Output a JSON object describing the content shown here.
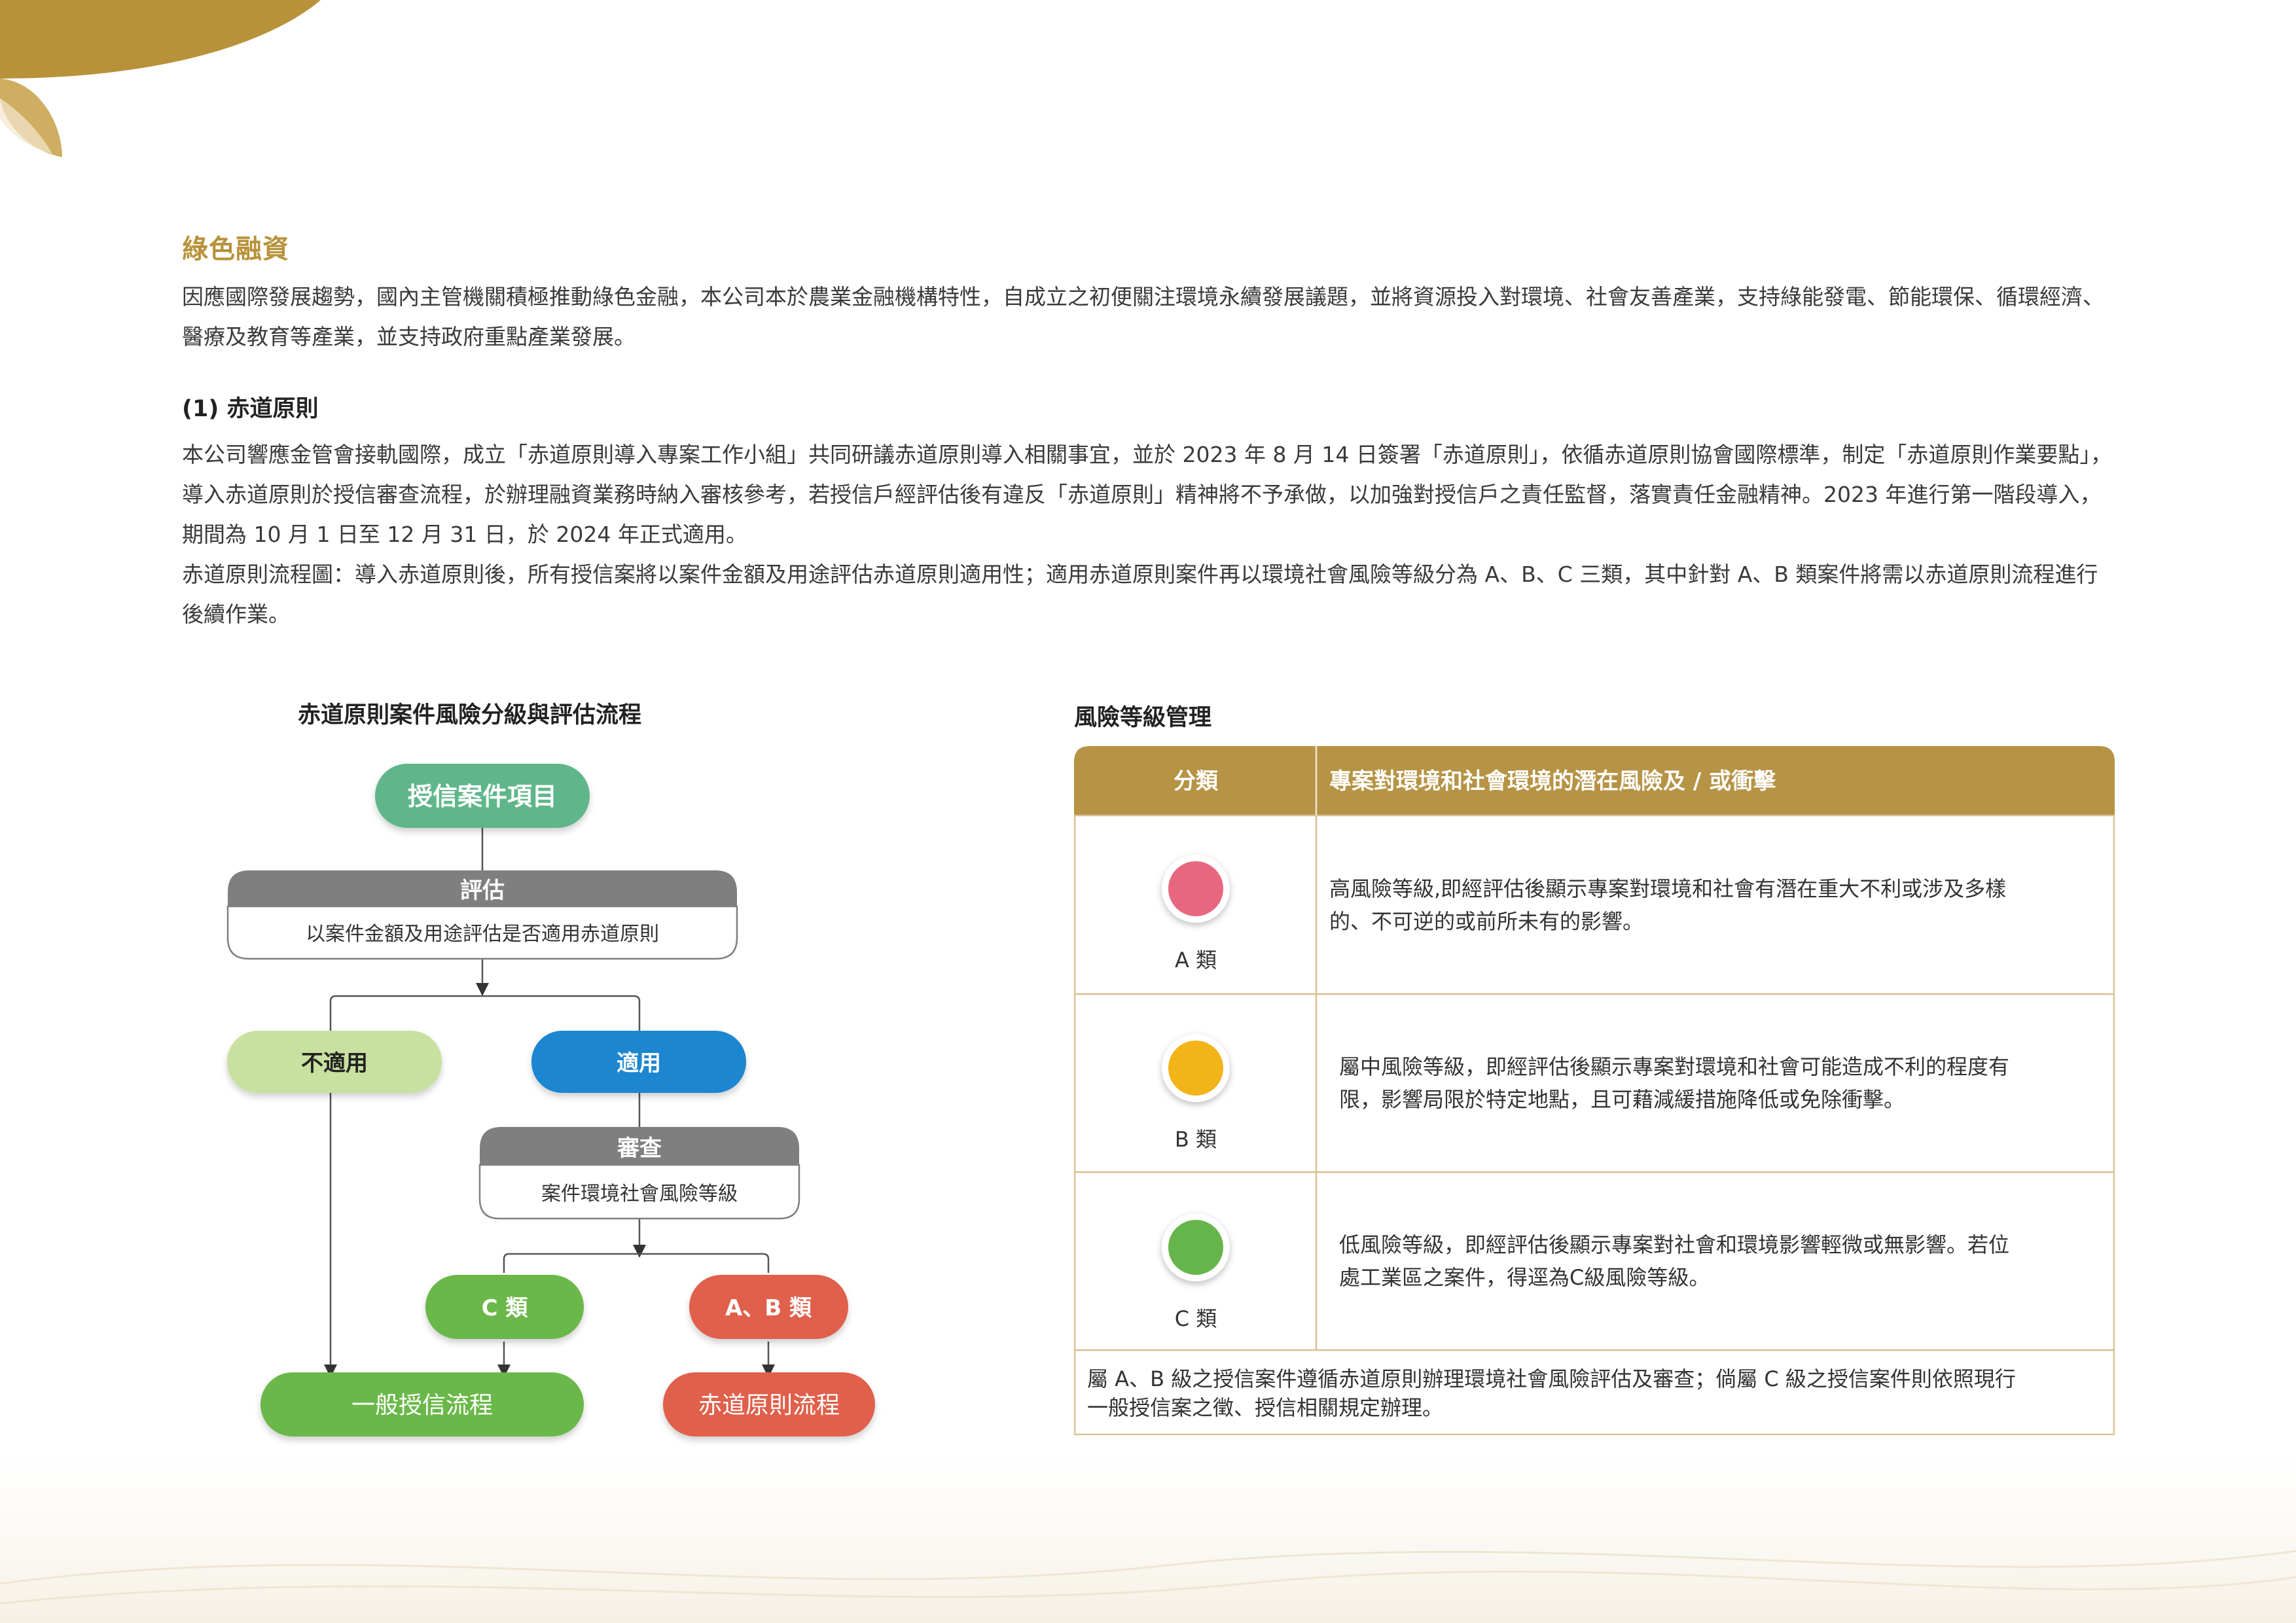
{
  "colors": {
    "gold": "#b8923a",
    "table_header": "#b69345",
    "table_border": "#d8c090",
    "green_pill": "#5fb68a",
    "gray_header": "#7f7f7f",
    "light_green": "#c9e1a0",
    "blue": "#1f86d1",
    "green": "#6ab84a",
    "red": "#e0604c",
    "dot_red": "#e7677f",
    "dot_yellow": "#f3b41a",
    "dot_green": "#66b54a"
  },
  "section": {
    "title": "綠色融資",
    "intro": "因應國際發展趨勢，國內主管機關積極推動綠色金融，本公司本於農業金融機構特性，自成立之初便關注環境永續發展議題，並將資源投入對環境、社會友善產業，支持綠能發電、節能環保、循環經濟、醫療及教育等產業，並支持政府重點產業發展。"
  },
  "equator": {
    "subtitle": "(1) 赤道原則",
    "paragraph1": "本公司響應金管會接軌國際，成立「赤道原則導入專案工作小組」共同研議赤道原則導入相關事宜，並於 2023 年 8 月 14 日簽署「赤道原則」，依循赤道原則協會國際標準，制定「赤道原則作業要點」，導入赤道原則於授信審查流程，於辦理融資業務時納入審核參考，若授信戶經評估後有違反「赤道原則」精神將不予承做，以加強對授信戶之責任監督，落實責任金融精神。2023 年進行第一階段導入，期間為 10 月 1 日至 12 月 31 日，於 2024 年正式適用。",
    "paragraph2": "赤道原則流程圖：導入赤道原則後，所有授信案將以案件金額及用途評估赤道原則適用性；適用赤道原則案件再以環境社會風險等級分為 A、B、C 三類，其中針對 A、B 類案件將需以赤道原則流程進行後續作業。"
  },
  "flowchart": {
    "title": "赤道原則案件風險分級與評估流程",
    "start": "授信案件項目",
    "evaluate_title": "評估",
    "evaluate_desc": "以案件金額及用途評估是否適用赤道原則",
    "not_applicable": "不適用",
    "applicable": "適用",
    "review_title": "審查",
    "review_desc": "案件環境社會風險等級",
    "class_c": "C 類",
    "class_ab": "A、B 類",
    "general_process": "一般授信流程",
    "equator_process": "赤道原則流程"
  },
  "risk_table": {
    "title": "風險等級管理",
    "header_category": "分類",
    "header_impact": "專案對環境和社會環境的潛在風險及 / 或衝擊",
    "rows": [
      {
        "label": "A 類",
        "dot": "red",
        "desc_lines": [
          "高風險等級,即經評估後顯示專案對環境和社會有潛在重大不利或涉及多樣",
          "的、不可逆的或前所未有的影響。"
        ]
      },
      {
        "label": "B 類",
        "dot": "yellow",
        "desc_lines": [
          "屬中風險等級，即經評估後顯示專案對環境和社會可能造成不利的程度有",
          "限，影響局限於特定地點，且可藉減緩措施降低或免除衝擊。"
        ]
      },
      {
        "label": "C 類",
        "dot": "green",
        "desc_lines": [
          "低風險等級，即經評估後顯示專案對社會和環境影響輕微或無影響。若位",
          "處工業區之案件，得逕為C級風險等級。"
        ]
      }
    ],
    "footnote_lines": [
      "屬 A、B 級之授信案件遵循赤道原則辦理環境社會風險評估及審查；倘屬 C 級之授信案件則依照現行",
      "一般授信案之徵、授信相關規定辦理。"
    ]
  }
}
